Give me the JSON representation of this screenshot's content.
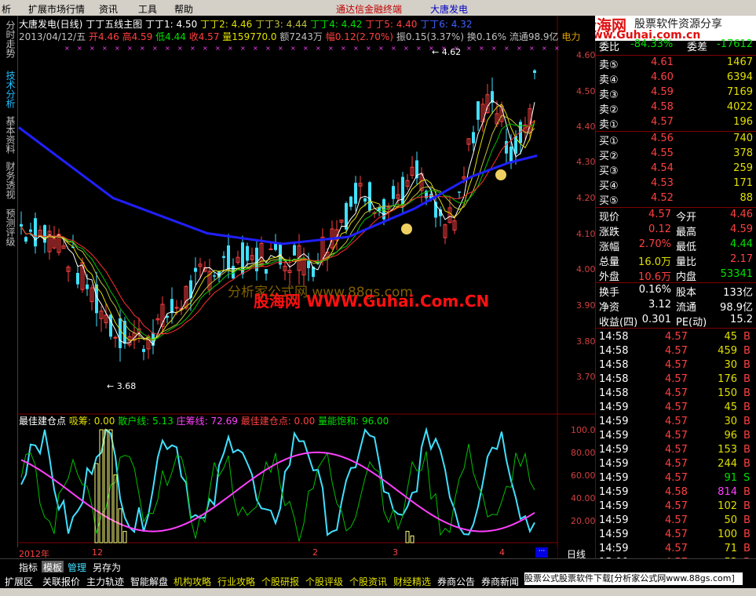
{
  "menu": {
    "items": [
      "析",
      "扩展市场行情",
      "资讯",
      "工具",
      "帮助"
    ],
    "center_title": "通达信金融终端",
    "stock_name_menu": "大唐发电",
    "brand": "股海网",
    "brand_slogan": "股票软件资源分享",
    "brand_url": "www.Guhai.com.cn"
  },
  "side_tabs": [
    {
      "label": "分时走势",
      "active": false
    },
    {
      "label": "技术分析",
      "active": true
    },
    {
      "label": "基本资料",
      "active": false
    },
    {
      "label": "财务透视",
      "active": false
    },
    {
      "label": "预测评级",
      "active": false
    }
  ],
  "chart_header": {
    "stock": "大唐发电(日线)",
    "indicator": "丁丁五线主图",
    "ma1": "丁丁1: 4.50",
    "ma2": "丁丁2: 4.46",
    "ma3": "丁丁3: 4.44",
    "ma4": "丁丁4: 4.42",
    "ma5": "丁丁5: 4.40",
    "ma6": "丁丁6: 4.32"
  },
  "info_line": {
    "date": "2013/04/12/五",
    "open": "开4.46",
    "high": "高4.59",
    "low": "低4.44",
    "close": "收4.57",
    "vol": "量159770.0",
    "amount": "额7243万",
    "change": "幅0.12(2.70%)",
    "amp": "振0.15(3.37%)",
    "turnover": "换0.16%",
    "float": "流通98.9亿",
    "sector": "电力"
  },
  "price_annotations": {
    "high_mark": "4.62",
    "low_mark": "3.68"
  },
  "price_axis": [
    "4.60",
    "4.50",
    "4.40",
    "4.30",
    "4.20",
    "4.10",
    "4.00",
    "3.90",
    "3.80",
    "3.70"
  ],
  "indicator": {
    "name": "最佳建仓点",
    "xichou": "吸筹: 0.00",
    "sanhu": "散户线: 5.13",
    "zhuangchou": "庄筹线: 72.69",
    "jiancang": "最佳建仓点: 0.00",
    "liangneng": "量能饱和: 96.00",
    "axis": [
      "100.0",
      "80.00",
      "60.00",
      "40.00",
      "20.00"
    ]
  },
  "time_axis": {
    "labels": [
      "2012年",
      "12",
      "2",
      "3",
      "4"
    ],
    "mode": "日线"
  },
  "watermark": {
    "text1": "分析家公式网 www.88gs.com",
    "text2": "股海网 WWW.Guhai.Com.CN"
  },
  "quote": {
    "weibi": {
      "label": "委比",
      "value": "-84.33%",
      "label2": "委差",
      "value2": "-17612"
    },
    "sell": [
      {
        "label": "卖⑤",
        "price": "4.61",
        "vol": "1467"
      },
      {
        "label": "卖④",
        "price": "4.60",
        "vol": "6394"
      },
      {
        "label": "卖③",
        "price": "4.59",
        "vol": "7169"
      },
      {
        "label": "卖②",
        "price": "4.58",
        "vol": "4022"
      },
      {
        "label": "卖①",
        "price": "4.57",
        "vol": "196"
      }
    ],
    "buy": [
      {
        "label": "买①",
        "price": "4.56",
        "vol": "740"
      },
      {
        "label": "买②",
        "price": "4.55",
        "vol": "378"
      },
      {
        "label": "买③",
        "price": "4.54",
        "vol": "259"
      },
      {
        "label": "买④",
        "price": "4.53",
        "vol": "171"
      },
      {
        "label": "买⑤",
        "price": "4.52",
        "vol": "88"
      }
    ],
    "stats": [
      {
        "l1": "现价",
        "v1": "4.57",
        "l2": "今开",
        "v2": "4.46"
      },
      {
        "l1": "涨跌",
        "v1": "0.12",
        "l2": "最高",
        "v2": "4.59"
      },
      {
        "l1": "涨幅",
        "v1": "2.70%",
        "l2": "最低",
        "v2": "4.44"
      },
      {
        "l1": "总量",
        "v1": "16.0万",
        "l2": "量比",
        "v2": "2.17"
      },
      {
        "l1": "外盘",
        "v1": "10.6万",
        "l2": "内盘",
        "v2": "53341"
      }
    ],
    "stats2": [
      {
        "l1": "换手",
        "v1": "0.16%",
        "l2": "股本",
        "v2": "133亿"
      },
      {
        "l1": "净资",
        "v1": "3.12",
        "l2": "流通",
        "v2": "98.9亿"
      },
      {
        "l1": "收益(四)",
        "v1": "0.301",
        "l2": "PE(动)",
        "v2": "15.2"
      }
    ],
    "ticks": [
      {
        "time": "14:58",
        "price": "4.57",
        "vol": "45",
        "side": "B"
      },
      {
        "time": "14:58",
        "price": "4.57",
        "vol": "459",
        "side": "B"
      },
      {
        "time": "14:58",
        "price": "4.57",
        "vol": "30",
        "side": "B"
      },
      {
        "time": "14:58",
        "price": "4.57",
        "vol": "176",
        "side": "B"
      },
      {
        "time": "14:58",
        "price": "4.57",
        "vol": "150",
        "side": "B"
      },
      {
        "time": "14:59",
        "price": "4.57",
        "vol": "45",
        "side": "B"
      },
      {
        "time": "14:59",
        "price": "4.57",
        "vol": "30",
        "side": "B"
      },
      {
        "time": "14:59",
        "price": "4.57",
        "vol": "96",
        "side": "B"
      },
      {
        "time": "14:59",
        "price": "4.57",
        "vol": "153",
        "side": "B"
      },
      {
        "time": "14:59",
        "price": "4.57",
        "vol": "244",
        "side": "B"
      },
      {
        "time": "14:59",
        "price": "4.57",
        "vol": "91",
        "side": "S"
      },
      {
        "time": "14:59",
        "price": "4.58",
        "vol": "814",
        "side": "B"
      },
      {
        "time": "14:59",
        "price": "4.57",
        "vol": "102",
        "side": "B"
      },
      {
        "time": "14:59",
        "price": "4.57",
        "vol": "50",
        "side": "B"
      },
      {
        "time": "14:59",
        "price": "4.57",
        "vol": "100",
        "side": "B"
      },
      {
        "time": "14:59",
        "price": "4.57",
        "vol": "71",
        "side": "B"
      },
      {
        "time": "15:00",
        "price": "4.57",
        "vol": "53",
        "side": "B"
      }
    ]
  },
  "bottom_tabs": [
    "指标",
    "模板",
    "管理",
    "另存为"
  ],
  "bottom_nav": [
    "扩展区",
    "关联报价",
    "主力轨迹",
    "智能解盘",
    "机构攻略",
    "行业攻略",
    "个股研报",
    "个股评级",
    "个股资讯",
    "财经精选",
    "券商公告",
    "券商新闻"
  ],
  "bottom_right": "股票公式股票软件下载[分析家公式网www.88gs.com]"
}
